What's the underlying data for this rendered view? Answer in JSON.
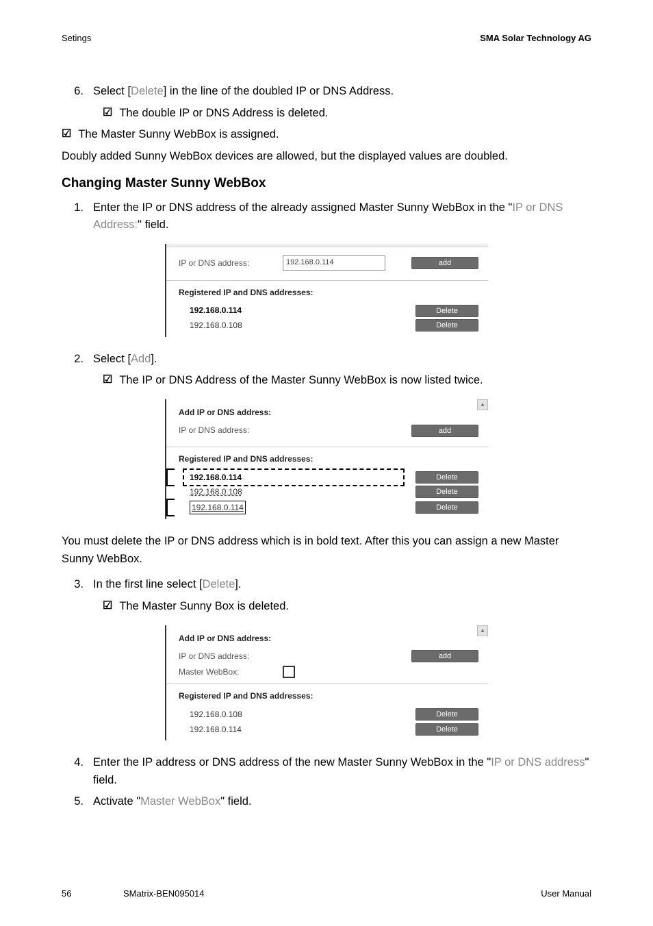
{
  "header": {
    "left": "Setings",
    "right": "SMA Solar Technology AG"
  },
  "section_title": "Changing Master Sunny WebBox",
  "steps": {
    "s6": {
      "num": "6.",
      "text_a": "Select [",
      "delete": "Delete",
      "text_b": "] in the line of the doubled IP or DNS Address.",
      "check": "The double IP or DNS Address is deleted."
    },
    "outer_check": "The Master Sunny WebBox is assigned.",
    "para1": "Doubly added Sunny WebBox devices are allowed, but the displayed values are doubled.",
    "s1": {
      "num": "1.",
      "text_a": "Enter the IP or DNS address of the already assigned Master Sunny WebBox in the \"",
      "field": "IP or DNS Address:",
      "text_b": "\" field."
    },
    "s2": {
      "num": "2.",
      "text_a": "Select [",
      "add": "Add",
      "text_b": "].",
      "check": "The IP or DNS Address of the Master Sunny WebBox is now listed twice."
    },
    "para2": "You must delete the IP or DNS address which is in bold text. After this you can assign a new Master Sunny WebBox.",
    "s3": {
      "num": "3.",
      "text_a": "In the first line select [",
      "delete": "Delete",
      "text_b": "].",
      "check": "The Master Sunny Box is deleted."
    },
    "s4": {
      "num": "4.",
      "text_a": "Enter the IP address or DNS address of the new Master Sunny WebBox in the \"",
      "field": "IP or DNS address",
      "text_b": "\" field."
    },
    "s5": {
      "num": "5.",
      "text_a": "Activate \"",
      "field": "Master WebBox",
      "text_b": "\" field."
    }
  },
  "fig_common": {
    "ip_label": "IP or DNS address:",
    "add_btn": "add",
    "reg_title": "Registered IP and DNS addresses:",
    "delete_btn": "Delete",
    "add_title": "Add IP or DNS address:",
    "master_label": "Master WebBox:"
  },
  "fig1": {
    "input_value": "192.168.0.114",
    "rows": [
      {
        "ip": "192.168.0.114",
        "bold": true
      },
      {
        "ip": "192.168.0.108",
        "bold": false
      }
    ]
  },
  "fig2": {
    "rows": [
      {
        "ip": "192.168.0.114",
        "bold": true
      },
      {
        "ip": "192.168.0.108",
        "bold": false
      },
      {
        "ip": "192.168.0.114",
        "bold": false,
        "underlined": true
      }
    ]
  },
  "fig3": {
    "rows": [
      {
        "ip": "192.168.0.108",
        "bold": false
      },
      {
        "ip": "192.168.0.114",
        "bold": false
      }
    ]
  },
  "footer": {
    "page": "56",
    "code": "SMatrix-BEN095014",
    "right": "User Manual"
  }
}
